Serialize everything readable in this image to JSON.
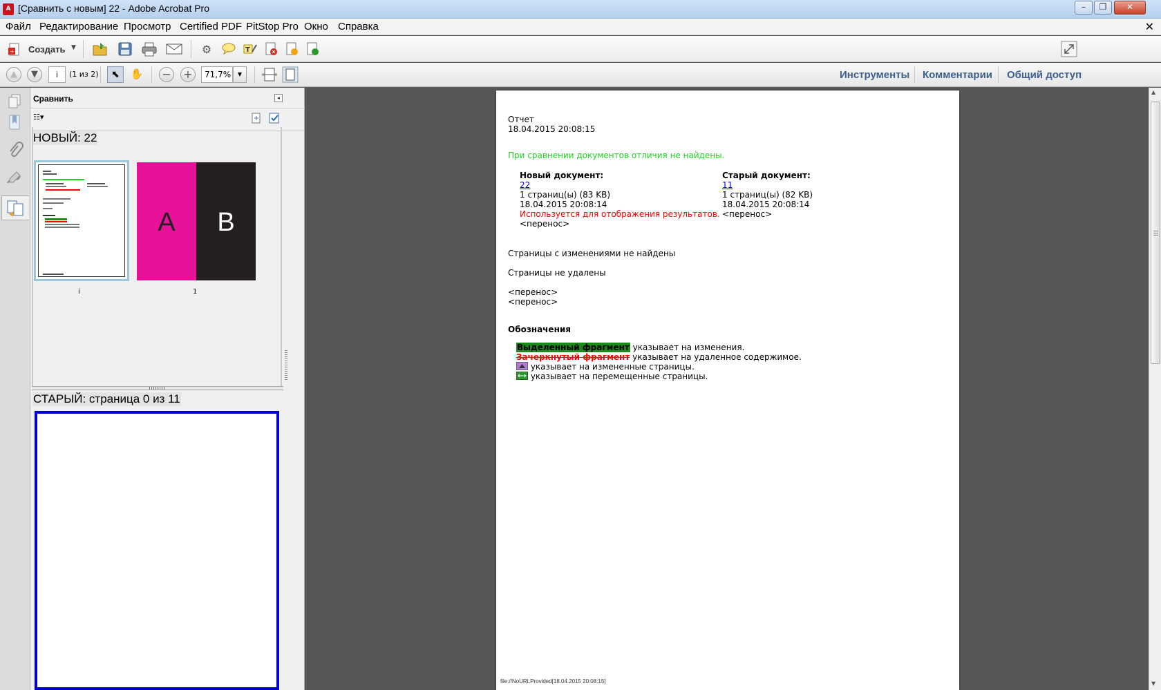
{
  "window": {
    "title": "[Сравнить с новым] 22 - Adobe Acrobat Pro",
    "minimize": "–",
    "maximize": "❐",
    "close": "✕"
  },
  "menu": {
    "items": [
      "Файл",
      "Редактирование",
      "Просмотр",
      "Certified PDF",
      "PitStop Pro",
      "Окно",
      "Справка"
    ],
    "close_doc": "✕"
  },
  "toolbar1": {
    "create_label": "Создать",
    "icons": [
      "open-folder-icon",
      "save-icon",
      "print-icon",
      "email-icon",
      "gear-icon",
      "comment-icon",
      "highlight-icon",
      "pitstop-red-icon",
      "pitstop-orange-icon",
      "pitstop-green-icon"
    ]
  },
  "toolbar2": {
    "page_value": "i",
    "page_count": "(1 из 2)",
    "zoom_value": "71,7%",
    "tools_label": "Инструменты",
    "comments_label": "Комментарии",
    "share_label": "Общий доступ"
  },
  "panel": {
    "title": "Сравнить",
    "new_label": "НОВЫЙ: 22",
    "thumb1_label": "i",
    "thumb2_label": "1",
    "thumb2_left": "A",
    "thumb2_right": "B",
    "old_label": "СТАРЫЙ: страница 0 из 11"
  },
  "report": {
    "heading": "Отчет",
    "date": "18.04.2015 20:08:15",
    "no_diff": "При сравнении документов отличия не найдены.",
    "new_doc": {
      "title": "Новый документ:",
      "name": "22",
      "pages": "1 страниц(ы) (83 KB)",
      "date": "18.04.2015 20:08:14",
      "note": "Используется для отображения результатов.",
      "wrap": "<перенос>"
    },
    "old_doc": {
      "title": "Старый документ:",
      "name": "11",
      "pages": "1 страниц(ы) (82 KB)",
      "date": "18.04.2015 20:08:14",
      "wrap": "<перенос>"
    },
    "no_changed_pages": "Страницы с изменениями не найдены",
    "no_deleted_pages": "Страницы не удалены",
    "wrap1": "<перенос>",
    "wrap2": "<перенос>",
    "legend_title": "Обозначения",
    "legend": {
      "highlighted": "Выделенный фрагмент",
      "highlighted_desc": " указывает на изменения.",
      "struck": "Зачеркнутый фрагмент",
      "struck_desc": " указывает на удаленное содержимое.",
      "changed_pages_desc": "указывает на измененные страницы.",
      "moved_pages_desc": "указывает на перемещенные страницы."
    },
    "footer": "file://NoURLProvided[18.04.2015 20:08:15]"
  },
  "colors": {
    "accent_link": "#3d5f8f",
    "green_text": "#1ed41e",
    "red_text": "#ff0000",
    "highlight_bg": "#1a8a1a",
    "thumb_magenta": "#e8129a",
    "thumb_dark": "#231f20",
    "old_page_border": "#0000cc"
  }
}
